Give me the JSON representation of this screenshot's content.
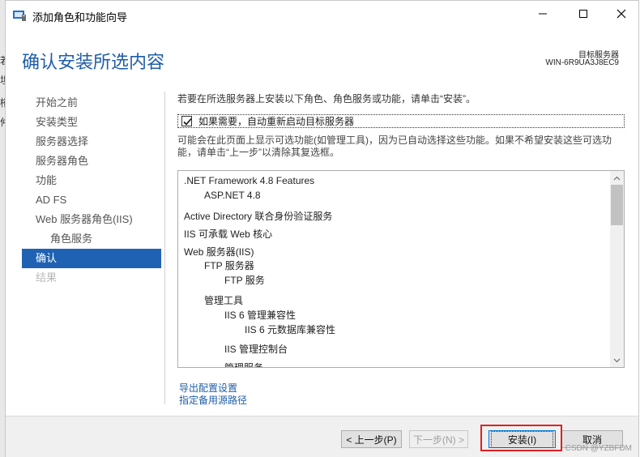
{
  "window": {
    "title": "添加角色和功能向导",
    "page_title": "确认安装所选内容",
    "target_label": "目标服务器",
    "target_name": "WIN-6R9UA3J8EC9"
  },
  "nav": {
    "items": [
      {
        "label": "开始之前",
        "state": "normal",
        "indent": false
      },
      {
        "label": "安装类型",
        "state": "normal",
        "indent": false
      },
      {
        "label": "服务器选择",
        "state": "normal",
        "indent": false
      },
      {
        "label": "服务器角色",
        "state": "normal",
        "indent": false
      },
      {
        "label": "功能",
        "state": "normal",
        "indent": false
      },
      {
        "label": "AD FS",
        "state": "normal",
        "indent": false
      },
      {
        "label": "Web 服务器角色(IIS)",
        "state": "normal",
        "indent": false
      },
      {
        "label": "角色服务",
        "state": "normal",
        "indent": true
      },
      {
        "label": "确认",
        "state": "active",
        "indent": false
      },
      {
        "label": "结果",
        "state": "disabled",
        "indent": false
      }
    ]
  },
  "main": {
    "intro": "若要在所选服务器上安装以下角色、角色服务或功能，请单击“安装”。",
    "restart_checkbox": {
      "label": "如果需要，自动重新启动目标服务器",
      "checked": true
    },
    "note": "可能会在此页面上显示可选功能(如管理工具)，因为已自动选择这些功能。如果不希望安装这些可选功能，请单击“上一步”以清除其复选框。",
    "features": [
      {
        "label": ".NET Framework 4.8 Features",
        "level": 0
      },
      {
        "label": "ASP.NET 4.8",
        "level": 1
      },
      {
        "label": "Active Directory 联合身份验证服务",
        "level": 0
      },
      {
        "label": "IIS 可承载 Web 核心",
        "level": 0
      },
      {
        "label": "Web 服务器(IIS)",
        "level": 0
      },
      {
        "label": "FTP 服务器",
        "level": 1
      },
      {
        "label": "FTP 服务",
        "level": 2
      },
      {
        "label": "管理工具",
        "level": 1
      },
      {
        "label": "IIS 6 管理兼容性",
        "level": 2
      },
      {
        "label": "IIS 6 元数据库兼容性",
        "level": 3
      },
      {
        "label": "IIS 管理控制台",
        "level": 2
      },
      {
        "label": "管理服务",
        "level": 2
      }
    ],
    "links": {
      "export": "导出配置设置",
      "alt_source": "指定备用源路径"
    }
  },
  "footer": {
    "prev": "< 上一步(P)",
    "next": "下一步(N) >",
    "install": "安装(I)",
    "cancel": "取消"
  },
  "background_fragments": [
    "若",
    "坦",
    "桁",
    "仲"
  ],
  "watermark": "CSDN @YZBFDM",
  "colors": {
    "accent": "#1f62b4",
    "title_blue": "#1f5ea8",
    "highlight_red": "#e02020"
  }
}
